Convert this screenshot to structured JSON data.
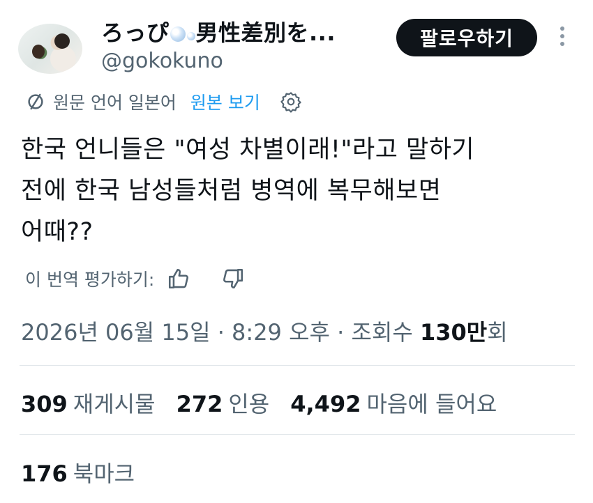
{
  "user": {
    "display_name_prefix": "ろっぴ",
    "display_name_suffix": "男性差別を...",
    "handle": "@gokokuno"
  },
  "follow_label": "팔로우하기",
  "translation": {
    "source_text": "원문 언어 일본어",
    "show_original": "원본 보기"
  },
  "tweet": {
    "lines": [
      "한국 언니들은 \"여성 차별이래!\"라고 말하기",
      "전에 한국 남성들처럼 병역에 복무해보면",
      "어때??"
    ]
  },
  "rate_translation": "이 번역 평가하기:",
  "meta": {
    "prefix": "2026년 06월 15일 · 8:29 오후 · 조회수 ",
    "views_num": "130만",
    "views_suffix": "회"
  },
  "stats": [
    {
      "count": "309",
      "label": "재게시물"
    },
    {
      "count": "272",
      "label": "인용"
    },
    {
      "count": "4,492",
      "label": "마음에 들어요"
    }
  ],
  "bookmarks": {
    "count": "176",
    "label": "북마크"
  },
  "colors": {
    "text": "#0f1419",
    "secondary": "#536471",
    "link": "#1d9bf0",
    "button": "#0f1419"
  }
}
